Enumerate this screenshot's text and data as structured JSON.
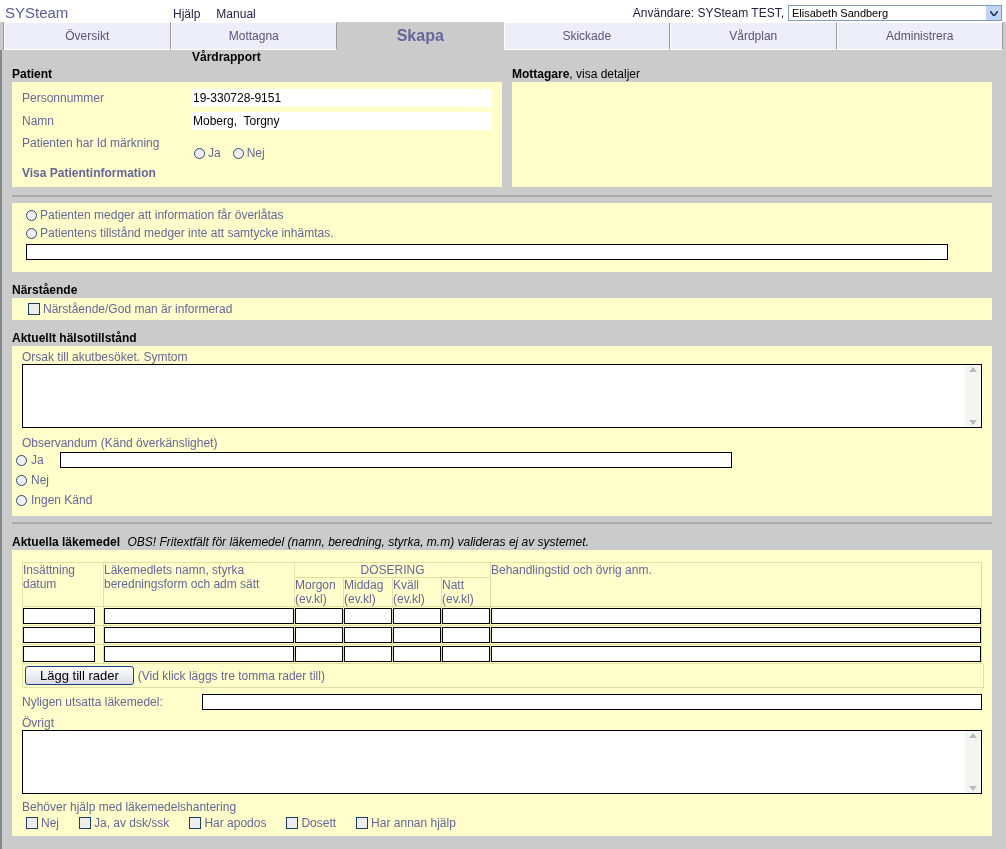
{
  "header": {
    "logo": "SYSteam",
    "links": [
      "Hjälp",
      "Manual"
    ],
    "user_label": "Användare: SYSteam TEST,",
    "user_select": "Elisabeth Sandberg"
  },
  "tabs": [
    {
      "label": "Översikt",
      "selected": false
    },
    {
      "label": "Mottagna",
      "selected": false
    },
    {
      "label": "Skapa",
      "selected": true
    },
    {
      "label": "Skickade",
      "selected": false
    },
    {
      "label": "Vårdplan",
      "selected": false
    },
    {
      "label": "Administrera",
      "selected": false
    }
  ],
  "form_title": "Vårdrapport",
  "patient": {
    "heading": "Patient",
    "fields": [
      {
        "label": "Personnummer",
        "value": "19-330728-9151"
      },
      {
        "label": "Namn",
        "value": "Moberg,  Torgny"
      }
    ],
    "id_label": "Patienten har Id märkning",
    "id_options": [
      {
        "label": "Ja",
        "selected": false
      },
      {
        "label": "Nej",
        "selected": false
      }
    ],
    "link": "Visa Patientinformation"
  },
  "recipient": {
    "heading": "**Mottagare**, visa detaljer"
  },
  "consent": {
    "options": [
      {
        "label": "Patienten medger att information får överlåtas",
        "selected": false
      },
      {
        "label": "Patientens tillstånd medger inte att samtycke inhämtas.",
        "selected": false
      }
    ]
  },
  "relatives": {
    "heading": "Närstående",
    "option": {
      "label": "Närstående/God man är informerad",
      "checked": false
    }
  },
  "health": {
    "heading": "Aktuellt hälsotillstånd",
    "reason_label": "Orsak till akutbesöket. Symtom",
    "observandum_label": "Observandum (Känd överkänslighet)",
    "observandum_options": [
      {
        "label": "Ja",
        "selected": false,
        "kind": "with_field"
      },
      {
        "label": "Nej",
        "selected": false,
        "kind": "plain"
      },
      {
        "label": "Ingen Känd",
        "selected": false,
        "kind": "plain"
      }
    ]
  },
  "medications": {
    "heading": "Aktuella läkemedel",
    "note": "OBS! Fritextfält för läkemedel (namn, beredning, styrka, m.m) valideras ej av systemet.",
    "columns": [
      "Insättning datum",
      "Läkemedlets namn, styrka beredningsform och adm sätt"
    ],
    "dose_group": "DOSERING",
    "dose_columns": [
      "Morgon (ev.kl)",
      "Middag (ev.kl)",
      "Kväll (ev.kl)",
      "Natt (ev.kl)"
    ],
    "last_column": "Behandlingstid och övrig anm.",
    "add_button": "Lägg till rader",
    "add_hint": "(Vid klick läggs tre tomma rader till)",
    "recent_label": "Nyligen utsatta läkemedel:",
    "other_label": "Övrigt",
    "help_label": "Behöver hjälp med läkemedelshantering",
    "help_options": [
      {
        "label": "Nej",
        "checked": false
      },
      {
        "label": "Ja, av dsk/ssk",
        "checked": false
      },
      {
        "label": "Har apodos",
        "checked": false
      },
      {
        "label": "Dosett",
        "checked": false
      },
      {
        "label": "Har annan hjälp",
        "checked": false
      }
    ]
  }
}
